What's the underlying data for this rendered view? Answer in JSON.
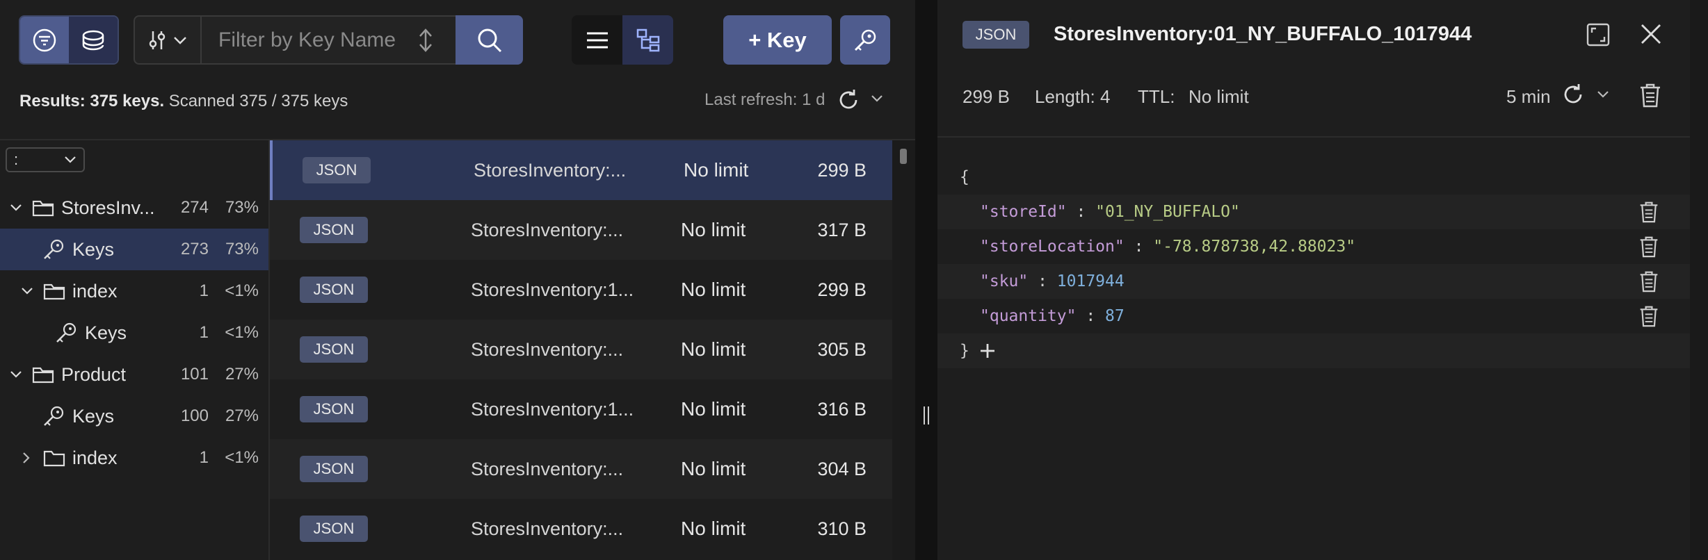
{
  "toolbar": {
    "search_placeholder": "Filter by Key Name",
    "add_key_label": "+ Key"
  },
  "results": {
    "summary_bold": "Results: 375 keys.",
    "summary_rest": " Scanned 375 / 375 keys",
    "last_refresh": "Last refresh: 1 d"
  },
  "tree": {
    "delimiter": ":",
    "items": [
      {
        "label": "StoresInv...",
        "count": "274",
        "pct": "73%"
      },
      {
        "label": "Keys",
        "count": "273",
        "pct": "73%"
      },
      {
        "label": "index",
        "count": "1",
        "pct": "<1%"
      },
      {
        "label": "Keys",
        "count": "1",
        "pct": "<1%"
      },
      {
        "label": "Product",
        "count": "101",
        "pct": "27%"
      },
      {
        "label": "Keys",
        "count": "100",
        "pct": "27%"
      },
      {
        "label": "index",
        "count": "1",
        "pct": "<1%"
      }
    ]
  },
  "keys": [
    {
      "type": "JSON",
      "name": "StoresInventory:...",
      "ttl": "No limit",
      "size": "299 B"
    },
    {
      "type": "JSON",
      "name": "StoresInventory:...",
      "ttl": "No limit",
      "size": "317 B"
    },
    {
      "type": "JSON",
      "name": "StoresInventory:1...",
      "ttl": "No limit",
      "size": "299 B"
    },
    {
      "type": "JSON",
      "name": "StoresInventory:...",
      "ttl": "No limit",
      "size": "305 B"
    },
    {
      "type": "JSON",
      "name": "StoresInventory:1...",
      "ttl": "No limit",
      "size": "316 B"
    },
    {
      "type": "JSON",
      "name": "StoresInventory:...",
      "ttl": "No limit",
      "size": "304 B"
    },
    {
      "type": "JSON",
      "name": "StoresInventory:...",
      "ttl": "No limit",
      "size": "310 B"
    }
  ],
  "details": {
    "type": "JSON",
    "key_name": "StoresInventory:01_NY_BUFFALO_1017944",
    "size": "299 B",
    "length": "Length: 4",
    "ttl_label": "TTL:",
    "ttl_value": "No limit",
    "auto_refresh": "5 min",
    "json": {
      "open": "{",
      "close": "}",
      "entries": [
        {
          "key": "\"storeId\"",
          "value": "\"01_NY_BUFFALO\"",
          "kind": "string"
        },
        {
          "key": "\"storeLocation\"",
          "value": "\"-78.878738,42.88023\"",
          "kind": "string"
        },
        {
          "key": "\"sku\"",
          "value": "1017944",
          "kind": "number"
        },
        {
          "key": "\"quantity\"",
          "value": "87",
          "kind": "number"
        }
      ]
    }
  },
  "colors": {
    "accent": "#4f5c8e",
    "selected_row": "#2b3555",
    "json_key": "#c49cd8",
    "json_string": "#b8cc86",
    "json_number": "#7fb0dc"
  }
}
